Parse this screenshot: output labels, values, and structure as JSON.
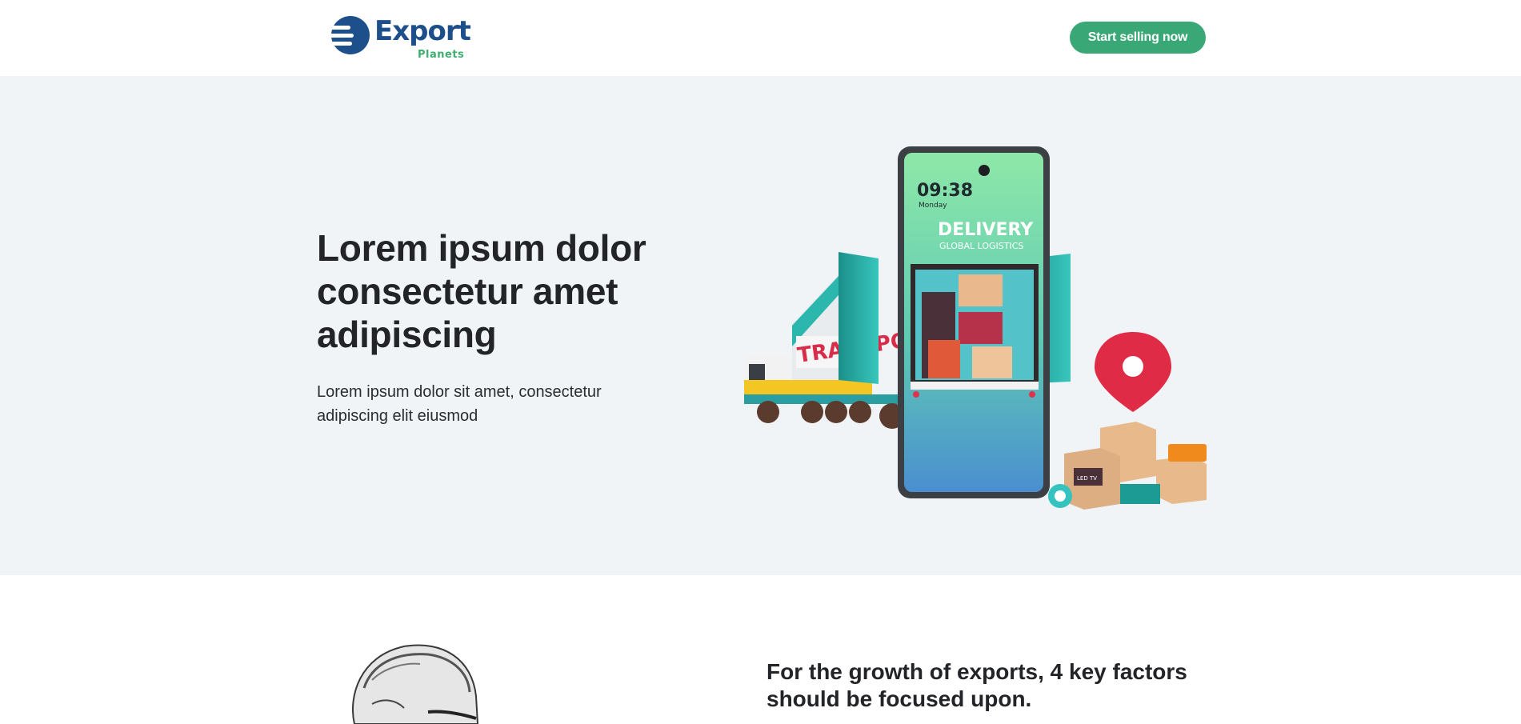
{
  "header": {
    "logo": {
      "word": "Export",
      "sub": "Planets",
      "icon": "logo-mark-icon"
    },
    "cta_label": "Start selling now"
  },
  "hero": {
    "title": "Lorem ipsum dolor consectetur amet adipiscing",
    "subtitle": "Lorem ipsum dolor sit amet, consectetur adipiscing elit eiusmod",
    "illustration": {
      "phone_time": "09:38",
      "phone_day": "Monday",
      "phone_heading": "DELIVERY",
      "phone_sub": "GLOBAL LOGISTICS",
      "truck_text": "TRANSPO",
      "box_label": "LED TV"
    }
  },
  "factors": {
    "title": "For the growth of exports, 4 key factors should be focused upon."
  },
  "colors": {
    "brand_blue": "#1d4f8b",
    "brand_green": "#3fae71",
    "cta_green": "#3aa876",
    "hero_bg": "#f0f4f6"
  }
}
